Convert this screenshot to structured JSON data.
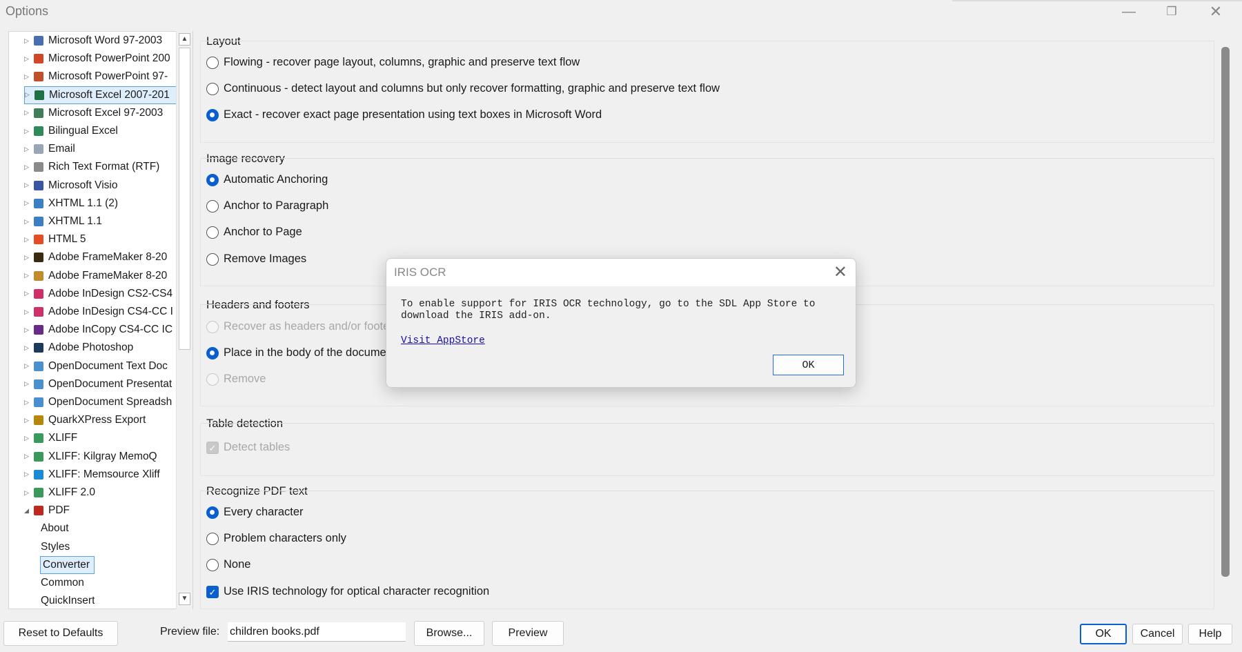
{
  "window": {
    "title": "Options"
  },
  "tree": {
    "items": [
      {
        "label": "Microsoft Word 97-2003",
        "icon": "word-doc-icon",
        "color": "#4a6fb0",
        "selected": false
      },
      {
        "label": "Microsoft PowerPoint 200",
        "icon": "powerpoint-icon",
        "color": "#d24726",
        "selected": false
      },
      {
        "label": "Microsoft PowerPoint 97-",
        "icon": "powerpoint-doc-icon",
        "color": "#c0502a",
        "selected": false
      },
      {
        "label": "Microsoft Excel 2007-201",
        "icon": "excel-icon",
        "color": "#1f7244",
        "selected": true
      },
      {
        "label": "Microsoft Excel 97-2003",
        "icon": "excel-doc-icon",
        "color": "#3f7e5a",
        "selected": false
      },
      {
        "label": "Bilingual Excel",
        "icon": "bilingual-excel-icon",
        "color": "#2e8b57",
        "selected": false
      },
      {
        "label": "Email",
        "icon": "email-icon",
        "color": "#9aa5b5",
        "selected": false
      },
      {
        "label": "Rich Text Format (RTF)",
        "icon": "rtf-icon",
        "color": "#8a8a8a",
        "selected": false
      },
      {
        "label": "Microsoft Visio",
        "icon": "visio-icon",
        "color": "#3955a3",
        "selected": false
      },
      {
        "label": "XHTML 1.1 (2)",
        "icon": "xhtml-icon",
        "color": "#3b7fc4",
        "selected": false
      },
      {
        "label": "XHTML 1.1",
        "icon": "xhtml-icon",
        "color": "#3b7fc4",
        "selected": false
      },
      {
        "label": "HTML 5",
        "icon": "html5-icon",
        "color": "#e44d26",
        "selected": false
      },
      {
        "label": "Adobe FrameMaker 8-20",
        "icon": "framemaker-icon",
        "color": "#3a2a10",
        "selected": false
      },
      {
        "label": "Adobe FrameMaker 8-20",
        "icon": "framemaker-icon",
        "color": "#c58a2a",
        "selected": false
      },
      {
        "label": "Adobe InDesign CS2-CS4",
        "icon": "indesign-icon",
        "color": "#d0306a",
        "selected": false
      },
      {
        "label": "Adobe InDesign CS4-CC I",
        "icon": "indesign-icon",
        "color": "#d0306a",
        "selected": false
      },
      {
        "label": "Adobe InCopy CS4-CC IC",
        "icon": "incopy-icon",
        "color": "#6a2a8a",
        "selected": false
      },
      {
        "label": "Adobe Photoshop",
        "icon": "photoshop-icon",
        "color": "#1b3a5c",
        "selected": false
      },
      {
        "label": "OpenDocument Text Doc",
        "icon": "odt-icon",
        "color": "#4a8fd0",
        "selected": false
      },
      {
        "label": "OpenDocument Presentat",
        "icon": "odp-icon",
        "color": "#4a8fd0",
        "selected": false
      },
      {
        "label": "OpenDocument Spreadsh",
        "icon": "ods-icon",
        "color": "#4a8fd0",
        "selected": false
      },
      {
        "label": "QuarkXPress Export",
        "icon": "quark-icon",
        "color": "#b8860b",
        "selected": false
      },
      {
        "label": "XLIFF",
        "icon": "xliff-icon",
        "color": "#3a9a5a",
        "selected": false
      },
      {
        "label": "XLIFF: Kilgray MemoQ",
        "icon": "memoq-icon",
        "color": "#3a9a5a",
        "selected": false
      },
      {
        "label": "XLIFF: Memsource Xliff",
        "icon": "memsource-icon",
        "color": "#1a8ad4",
        "selected": false
      },
      {
        "label": "XLIFF 2.0",
        "icon": "xliff-icon",
        "color": "#3a9a5a",
        "selected": false
      },
      {
        "label": "PDF",
        "icon": "pdf-icon",
        "color": "#c0281e",
        "selected": false,
        "expanded": true
      }
    ],
    "subitems": [
      {
        "label": "About",
        "selected": false
      },
      {
        "label": "Styles",
        "selected": false
      },
      {
        "label": "Converter",
        "selected": true
      },
      {
        "label": "Common",
        "selected": false
      },
      {
        "label": "QuickInsert",
        "selected": false
      }
    ]
  },
  "layout": {
    "title": "Layout",
    "options": [
      "Flowing - recover page layout, columns, graphic and preserve text flow",
      "Continuous - detect layout and columns but only recover formatting, graphic and preserve text flow",
      "Exact - recover exact page presentation using text boxes in Microsoft Word"
    ],
    "selected_index": 2
  },
  "image_recovery": {
    "title": "Image recovery",
    "options": [
      "Automatic Anchoring",
      "Anchor to Paragraph",
      "Anchor to Page",
      "Remove Images"
    ],
    "selected_index": 0
  },
  "headers_footers": {
    "title": "Headers and footers",
    "options": [
      "Recover as headers and/or footer",
      "Place in the body of the documen",
      "Remove"
    ],
    "selected_index": 1
  },
  "table_detection": {
    "title": "Table detection",
    "checkbox_label": "Detect tables"
  },
  "recognize_pdf": {
    "title": "Recognize PDF text",
    "options": [
      "Every character",
      "Problem characters only",
      "None"
    ],
    "selected_index": 0,
    "iris_label": "Use IRIS technology for optical character recognition"
  },
  "bottom": {
    "reset_label": "Reset to Defaults",
    "preview_file_label": "Preview file:",
    "preview_file_value": "children books.pdf",
    "browse_label": "Browse...",
    "preview_label": "Preview",
    "ok_label": "OK",
    "cancel_label": "Cancel",
    "help_label": "Help"
  },
  "dialog": {
    "title": "IRIS OCR",
    "message_line1": "To enable support for IRIS OCR technology, go to the SDL App Store to",
    "message_line2": "download the IRIS add-on.",
    "link": "Visit AppStore",
    "ok_label": "OK"
  }
}
